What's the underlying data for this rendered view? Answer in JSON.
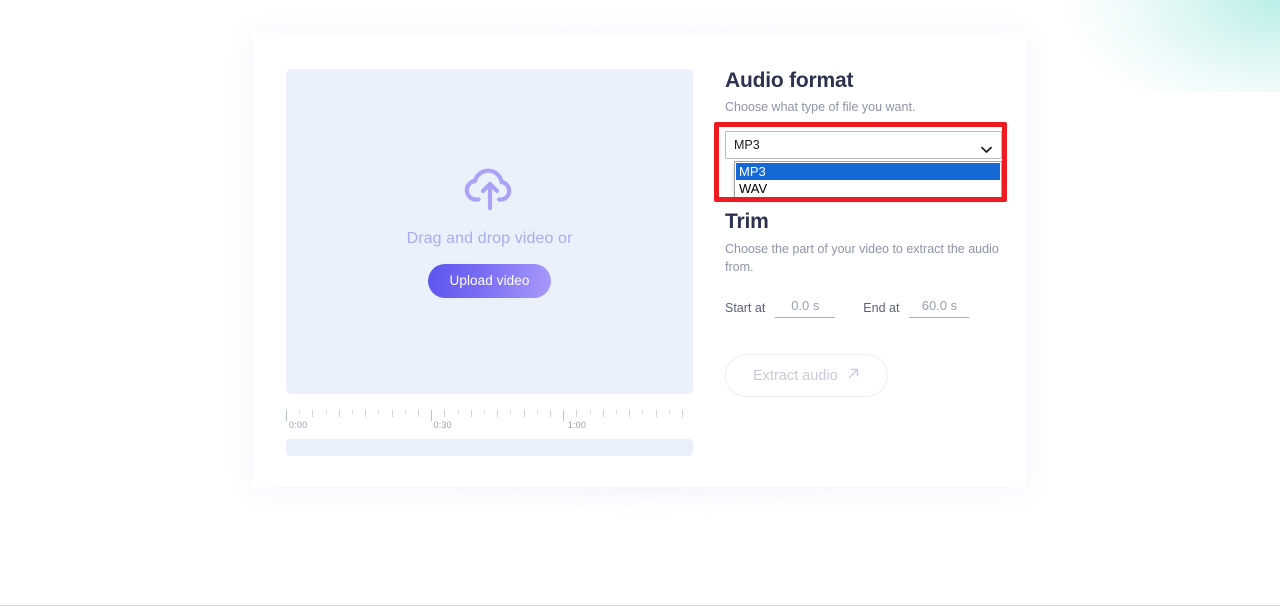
{
  "audio_format": {
    "title": "Audio format",
    "subtitle": "Choose what type of file you want.",
    "select": {
      "name": "audio-format-select",
      "value": "MP3",
      "expanded": true,
      "options": [
        {
          "label": "MP3",
          "selected": true
        },
        {
          "label": "WAV",
          "selected": false
        }
      ],
      "chevron_icon": "chevron-down-icon"
    }
  },
  "trim": {
    "title": "Trim",
    "subtitle": "Choose the part of your video to extract the audio from.",
    "start_label": "Start at",
    "start_value": "0.0 s",
    "end_label": "End at",
    "end_value": "60.0 s"
  },
  "action": {
    "extract_label": "Extract audio",
    "extract_icon": "arrow-up-right-icon",
    "disabled": true
  },
  "dropzone": {
    "icon": "cloud-upload-icon",
    "text": "Drag and drop video or",
    "upload_label": "Upload video"
  },
  "timeline": {
    "labels": [
      {
        "text": "0:00",
        "pos_pct": 0
      },
      {
        "text": "0:30",
        "pos_pct": 35.5
      },
      {
        "text": "1:00",
        "pos_pct": 68.5
      }
    ]
  },
  "annotation": {
    "highlight_color": "#ee1b22",
    "target": "audio-format-select"
  },
  "colors": {
    "accent_purple": "#6b5cf0",
    "dropzone_bg": "#eaf1fb",
    "heading": "#2d3250",
    "muted": "#8d94a8",
    "option_highlight": "#1569d6",
    "corner_teal": "#b9efe9"
  }
}
